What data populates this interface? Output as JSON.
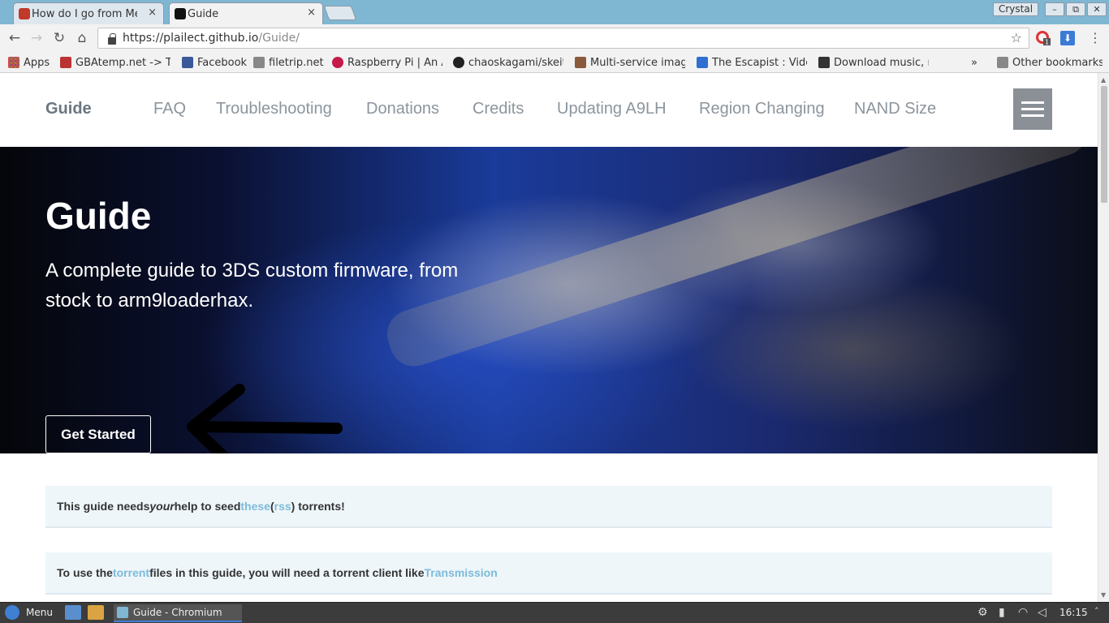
{
  "browser": {
    "tabs": [
      {
        "title": "How do I go from Men",
        "close": "×"
      },
      {
        "title": "Guide",
        "close": "×"
      }
    ],
    "user": "Crystal",
    "window_buttons": {
      "minimize": "–",
      "restore": "⧉",
      "close": "✕"
    },
    "nav": {
      "back": "←",
      "forward": "→",
      "reload": "↻",
      "home": "⌂"
    },
    "url": {
      "host": "https://plailect.github.io",
      "path": "/Guide/"
    },
    "star": "☆",
    "menu": "⋮",
    "ext_badge": "1",
    "download_icon": "⬇"
  },
  "bookmarks": {
    "items": [
      {
        "label": "Apps"
      },
      {
        "label": "GBAtemp.net -> Th"
      },
      {
        "label": "Facebook"
      },
      {
        "label": "filetrip.net"
      },
      {
        "label": "Raspberry Pi | An A"
      },
      {
        "label": "chaoskagami/skeith"
      },
      {
        "label": "Multi-service image"
      },
      {
        "label": "The Escapist : Vide"
      },
      {
        "label": "Download music, m"
      }
    ],
    "overflow": "»",
    "other": "Other bookmarks"
  },
  "site": {
    "nav": {
      "brand": "Guide",
      "links": [
        "FAQ",
        "Troubleshooting",
        "Donations",
        "Credits",
        "Updating A9LH",
        "Region Changing",
        "NAND Size"
      ]
    },
    "hero": {
      "title": "Guide",
      "subtitle": "A complete guide to 3DS custom firmware, from stock to arm9loaderhax.",
      "cta": "Get Started"
    },
    "notices": [
      {
        "pre": "This guide needs ",
        "em": "your",
        "mid": " help to seed ",
        "link1": "these",
        "paren_open": " (",
        "link2": "rss",
        "post": ") torrents!"
      },
      {
        "pre": "To use the ",
        "link1": "torrent",
        "mid": " files in this guide, you will need a torrent client like ",
        "link2": "Transmission"
      }
    ]
  },
  "taskbar": {
    "menu": "Menu",
    "window": "Guide - Chromium",
    "clock": "16:15"
  }
}
